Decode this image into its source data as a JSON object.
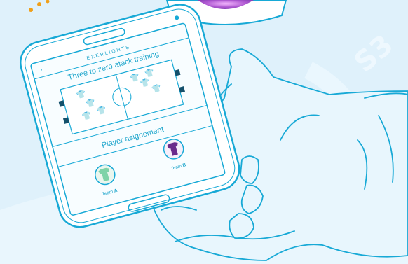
{
  "app": {
    "brand": "EXERLIGHTS",
    "back_icon": "chevron-left-icon"
  },
  "screen": {
    "title": "Three to zero atack training",
    "section_title": "Player asignement",
    "team_a": {
      "prefix": "Team",
      "suffix": "A",
      "jersey_color": "#7ed3a8"
    },
    "team_b": {
      "prefix": "Team",
      "suffix": "B",
      "jersey_color": "#6a2a8c"
    }
  },
  "colors": {
    "background": "#dff1fb",
    "line": "#17a9d6",
    "accent_orange": "#f0a019",
    "glow_purple": "#b05ad2"
  }
}
